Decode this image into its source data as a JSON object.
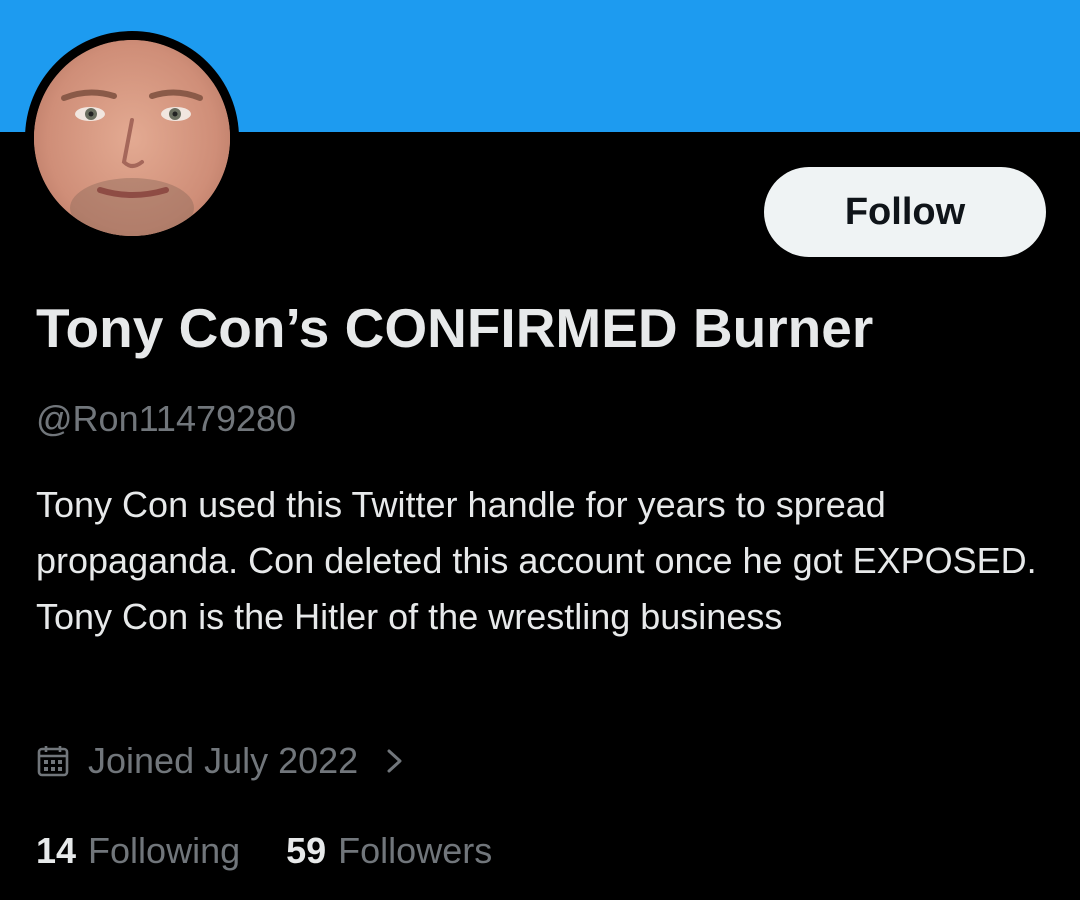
{
  "profile": {
    "display_name": "Tony Con’s CONFIRMED Burner",
    "handle": "@Ron11479280",
    "bio": "Tony Con used this Twitter handle for years to spread propaganda. Con deleted this account once he got EXPOSED. Tony Con is the Hitler of the wrestling business",
    "joined": "Joined July 2022",
    "following_count": "14",
    "following_label": "Following",
    "followers_count": "59",
    "followers_label": "Followers"
  },
  "actions": {
    "follow_label": "Follow"
  },
  "icons": {
    "joined": "calendar-icon",
    "joined_more": "chevron-right-icon"
  },
  "colors": {
    "banner": "#1d9bf0",
    "background": "#000000",
    "primary_text": "#e7e9ea",
    "secondary_text": "#71767b",
    "follow_button_bg": "#eff3f4"
  }
}
